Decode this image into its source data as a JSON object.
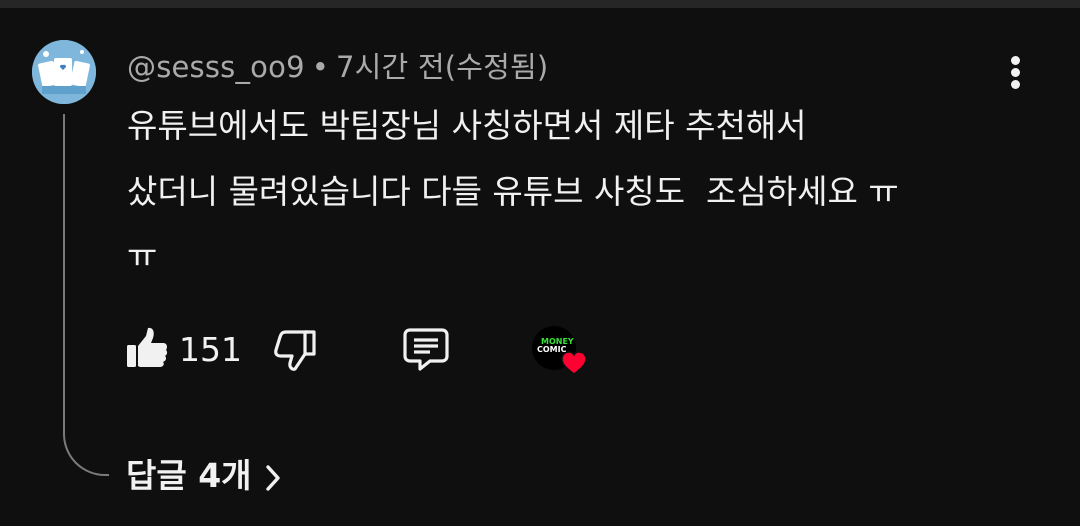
{
  "comment": {
    "author": "@sesss_oo9",
    "separator": "•",
    "time": "7시간 전(수정됨)",
    "lines": [
      "유튜브에서도 박팀장님 사칭하면서 제타 추천해서",
      "샀더니 물려있습니다 다들 유튜브 사칭도  조심하세요 ㅠ",
      "ㅠ"
    ],
    "like_count": "151",
    "creator_avatar_text": [
      "MONEY",
      "COMIC"
    ],
    "replies_label": "답글 4개"
  },
  "icons": {
    "more": "more-vertical-icon",
    "like": "thumbs-up-icon",
    "dislike": "thumbs-down-icon",
    "reply": "comment-reply-icon",
    "chevron": "chevron-right-icon",
    "heart": "heart-icon"
  },
  "colors": {
    "background": "#0f0f0f",
    "text_primary": "#f1f1f1",
    "text_secondary": "#aaaaaa",
    "heart": "#ff0033",
    "avatar_bg": "#7fb6db"
  }
}
